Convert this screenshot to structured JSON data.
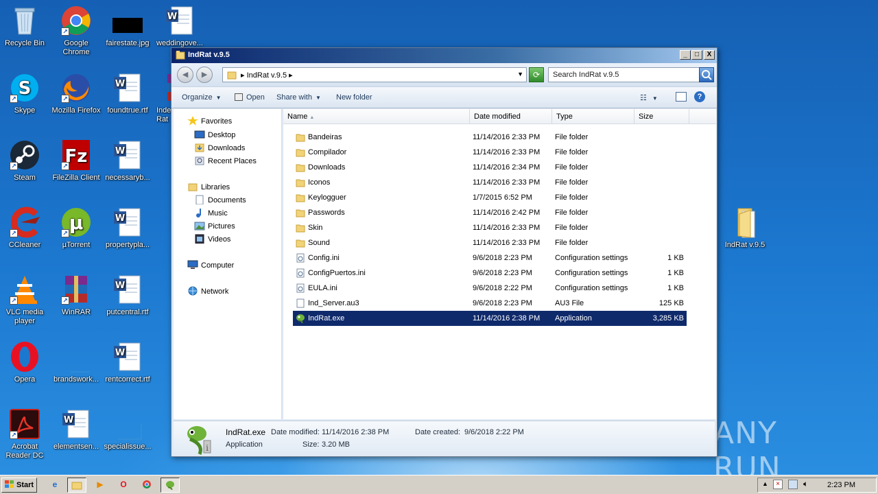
{
  "desktop": {
    "icons": [
      {
        "label": "Recycle Bin"
      },
      {
        "label": "Google Chrome"
      },
      {
        "label": "fairestate.jpg"
      },
      {
        "label": "weddingove..."
      },
      {
        "label": "Skype"
      },
      {
        "label": "Mozilla Firefox"
      },
      {
        "label": "foundtrue.rtf"
      },
      {
        "label": "Inde Rat"
      },
      {
        "label": "Steam"
      },
      {
        "label": "FileZilla Client"
      },
      {
        "label": "necessaryb..."
      },
      {
        "label": "CCleaner"
      },
      {
        "label": "µTorrent"
      },
      {
        "label": "propertypla..."
      },
      {
        "label": "VLC media player"
      },
      {
        "label": "WinRAR"
      },
      {
        "label": "putcentral.rtf"
      },
      {
        "label": "Opera"
      },
      {
        "label": "brandswork..."
      },
      {
        "label": "rentcorrect.rtf"
      },
      {
        "label": "Acrobat Reader DC"
      },
      {
        "label": "elementsen..."
      },
      {
        "label": "specialissue..."
      },
      {
        "label": "IndRat v.9.5"
      }
    ],
    "watermark": "ANY RUN"
  },
  "window": {
    "title": "IndRat v.9.5",
    "controls": {
      "minimize": "_",
      "maximize": "□",
      "close": "X"
    },
    "address": {
      "path": "IndRat v.9.5"
    },
    "search": {
      "placeholder": "Search IndRat v.9.5"
    },
    "toolbar": {
      "organize": "Organize",
      "open": "Open",
      "share_with": "Share with",
      "new_folder": "New folder"
    },
    "nav": {
      "favorites": "Favorites",
      "desktop": "Desktop",
      "downloads": "Downloads",
      "recent_places": "Recent Places",
      "libraries": "Libraries",
      "documents": "Documents",
      "music": "Music",
      "pictures": "Pictures",
      "videos": "Videos",
      "computer": "Computer",
      "network": "Network"
    },
    "columns": {
      "name": "Name",
      "date_modified": "Date modified",
      "type": "Type",
      "size": "Size"
    },
    "files": [
      {
        "name": "Bandeiras",
        "date": "11/14/2016 2:33 PM",
        "type": "File folder",
        "size": "",
        "icon": "folder-icon"
      },
      {
        "name": "Compilador",
        "date": "11/14/2016 2:33 PM",
        "type": "File folder",
        "size": "",
        "icon": "folder-icon"
      },
      {
        "name": "Downloads",
        "date": "11/14/2016 2:34 PM",
        "type": "File folder",
        "size": "",
        "icon": "folder-icon"
      },
      {
        "name": "Iconos",
        "date": "11/14/2016 2:33 PM",
        "type": "File folder",
        "size": "",
        "icon": "folder-icon"
      },
      {
        "name": "Keylogguer",
        "date": "1/7/2015 6:52 PM",
        "type": "File folder",
        "size": "",
        "icon": "folder-icon"
      },
      {
        "name": "Passwords",
        "date": "11/14/2016 2:42 PM",
        "type": "File folder",
        "size": "",
        "icon": "folder-icon"
      },
      {
        "name": "Skin",
        "date": "11/14/2016 2:33 PM",
        "type": "File folder",
        "size": "",
        "icon": "folder-icon"
      },
      {
        "name": "Sound",
        "date": "11/14/2016 2:33 PM",
        "type": "File folder",
        "size": "",
        "icon": "folder-icon"
      },
      {
        "name": "Config.ini",
        "date": "9/6/2018 2:23 PM",
        "type": "Configuration settings",
        "size": "1 KB",
        "icon": "config-file-icon"
      },
      {
        "name": "ConfigPuertos.ini",
        "date": "9/6/2018 2:23 PM",
        "type": "Configuration settings",
        "size": "1 KB",
        "icon": "config-file-icon"
      },
      {
        "name": "EULA.ini",
        "date": "9/6/2018 2:22 PM",
        "type": "Configuration settings",
        "size": "1 KB",
        "icon": "config-file-icon"
      },
      {
        "name": "Ind_Server.au3",
        "date": "9/6/2018 2:23 PM",
        "type": "AU3 File",
        "size": "125 KB",
        "icon": "file-icon"
      },
      {
        "name": "IndRat.exe",
        "date": "11/14/2016 2:38 PM",
        "type": "Application",
        "size": "3,285 KB",
        "icon": "app-icon",
        "selected": true
      }
    ],
    "details": {
      "name": "IndRat.exe",
      "modified_label": "Date modified:",
      "modified": "11/14/2016 2:38 PM",
      "created_label": "Date created:",
      "created": "9/6/2018 2:22 PM",
      "kind": "Application",
      "size_label": "Size:",
      "size": "3.20 MB"
    }
  },
  "taskbar": {
    "start": "Start",
    "clock": "2:23 PM"
  },
  "colors": {
    "selection": "#0f2a6b",
    "title_start": "#0a246a",
    "title_end": "#a6caf0",
    "desktop": "#1c78cf"
  }
}
